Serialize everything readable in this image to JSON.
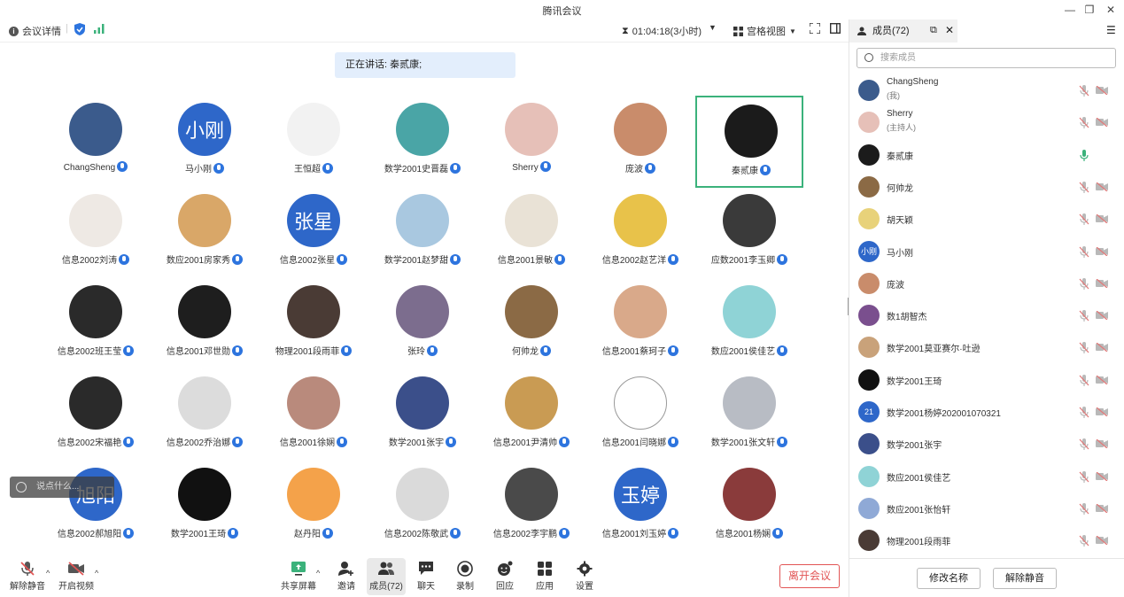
{
  "window": {
    "title": "腾讯会议"
  },
  "toolbar": {
    "meeting_info": "会议详情",
    "timer": "01:04:18(3小时)",
    "view_mode": "宫格视图"
  },
  "speaking_banner": "正在讲话: 秦贰康;",
  "grid": [
    {
      "name": "ChangSheng",
      "avatar_text": "",
      "color": "#3b5b8c"
    },
    {
      "name": "马小刚",
      "avatar_text": "小刚",
      "color": "#2e67c9"
    },
    {
      "name": "王恒超",
      "avatar_text": "",
      "color": "#f2f2f2"
    },
    {
      "name": "数学2001史晋磊",
      "avatar_text": "",
      "color": "#4aa5a6"
    },
    {
      "name": "Sherry",
      "avatar_text": "",
      "color": "#e6c0b8"
    },
    {
      "name": "庞波",
      "avatar_text": "",
      "color": "#c98c6b"
    },
    {
      "name": "秦贰康",
      "avatar_text": "",
      "color": "#1b1b1b",
      "active": true
    },
    {
      "name": "信息2002刘涛",
      "avatar_text": "",
      "color": "#eee9e4"
    },
    {
      "name": "数应2001房家秀",
      "avatar_text": "",
      "color": "#d9a768"
    },
    {
      "name": "信息2002张星",
      "avatar_text": "张星",
      "color": "#2e67c9"
    },
    {
      "name": "数学2001赵梦甜",
      "avatar_text": "",
      "color": "#a9c8e0"
    },
    {
      "name": "信息2001景敏",
      "avatar_text": "",
      "color": "#e9e2d6"
    },
    {
      "name": "信息2002赵艺洋",
      "avatar_text": "",
      "color": "#e8c24a"
    },
    {
      "name": "应数2001李玉卿",
      "avatar_text": "",
      "color": "#3a3a3a"
    },
    {
      "name": "信息2002班王莹",
      "avatar_text": "",
      "color": "#2a2a2a"
    },
    {
      "name": "信息2001邓世勋",
      "avatar_text": "",
      "color": "#1e1e1e"
    },
    {
      "name": "物理2001段雨菲",
      "avatar_text": "",
      "color": "#4a3b35"
    },
    {
      "name": "张玲",
      "avatar_text": "",
      "color": "#7c6d8e"
    },
    {
      "name": "何帅龙",
      "avatar_text": "",
      "color": "#8b6a45"
    },
    {
      "name": "信息2001蔡珂子",
      "avatar_text": "",
      "color": "#d9a98a"
    },
    {
      "name": "数应2001侯佳艺",
      "avatar_text": "",
      "color": "#8fd3d6"
    },
    {
      "name": "信息2002宋福艳",
      "avatar_text": "",
      "color": "#2a2a2a"
    },
    {
      "name": "信息2002乔治娜",
      "avatar_text": "",
      "color": "#dcdcdc"
    },
    {
      "name": "信息2001徐娴",
      "avatar_text": "",
      "color": "#b98a7c"
    },
    {
      "name": "数学2001张宇",
      "avatar_text": "",
      "color": "#3b4f8a"
    },
    {
      "name": "信息2001尹清帅",
      "avatar_text": "",
      "color": "#c99b53"
    },
    {
      "name": "信息2001闫晓娜",
      "avatar_text": "",
      "color": "#ffffff"
    },
    {
      "name": "数学2001张文轩",
      "avatar_text": "",
      "color": "#b8bcc4"
    },
    {
      "name": "信息2002郝旭阳",
      "avatar_text": "旭阳",
      "color": "#2e67c9"
    },
    {
      "name": "数学2001王琦",
      "avatar_text": "",
      "color": "#111111"
    },
    {
      "name": "赵丹阳",
      "avatar_text": "",
      "color": "#f4a24a"
    },
    {
      "name": "信息2002陈敬武",
      "avatar_text": "",
      "color": "#dadada"
    },
    {
      "name": "信息2002李宇鹏",
      "avatar_text": "",
      "color": "#4a4a4a"
    },
    {
      "name": "信息2001刘玉婷",
      "avatar_text": "玉婷",
      "color": "#2e67c9"
    },
    {
      "name": "信息2001杨娴",
      "avatar_text": "",
      "color": "#8a3b3b"
    }
  ],
  "chat_input": {
    "placeholder": "说点什么..."
  },
  "bottom": {
    "unmute": "解除静音",
    "start_video": "开启视频",
    "share_screen": "共享屏幕",
    "invite": "邀请",
    "members": "成员(72)",
    "chat": "聊天",
    "record": "录制",
    "reaction": "回应",
    "apps": "应用",
    "settings": "设置",
    "leave": "离开会议"
  },
  "panel": {
    "tab": "成员(72)",
    "search_placeholder": "搜索成员",
    "members": [
      {
        "name": "ChangSheng",
        "role": "(我)",
        "avatar_text": "",
        "color": "#3b5b8c",
        "mic": "muted"
      },
      {
        "name": "Sherry",
        "role": "(主持人)",
        "avatar_text": "",
        "color": "#e6c0b8",
        "mic": "muted"
      },
      {
        "name": "秦贰康",
        "role": "",
        "avatar_text": "",
        "color": "#1b1b1b",
        "mic": "on"
      },
      {
        "name": "何帅龙",
        "role": "",
        "avatar_text": "",
        "color": "#8b6a45",
        "mic": "muted"
      },
      {
        "name": "胡天颖",
        "role": "",
        "avatar_text": "",
        "color": "#e8d27a",
        "mic": "muted"
      },
      {
        "name": "马小刚",
        "role": "",
        "avatar_text": "小刚",
        "color": "#2e67c9",
        "mic": "muted"
      },
      {
        "name": "庞波",
        "role": "",
        "avatar_text": "",
        "color": "#c98c6b",
        "mic": "muted"
      },
      {
        "name": "数1胡智杰",
        "role": "",
        "avatar_text": "",
        "color": "#7a4f8e",
        "mic": "muted"
      },
      {
        "name": "数学2001莫亚赛尔·吐逊",
        "role": "",
        "avatar_text": "",
        "color": "#c9a27a",
        "mic": "muted"
      },
      {
        "name": "数学2001王琦",
        "role": "",
        "avatar_text": "",
        "color": "#111111",
        "mic": "muted"
      },
      {
        "name": "数学2001杨婷202001070321",
        "role": "",
        "avatar_text": "21",
        "color": "#2e67c9",
        "mic": "muted"
      },
      {
        "name": "数学2001张宇",
        "role": "",
        "avatar_text": "",
        "color": "#3b4f8a",
        "mic": "muted"
      },
      {
        "name": "数应2001侯佳艺",
        "role": "",
        "avatar_text": "",
        "color": "#8fd3d6",
        "mic": "muted"
      },
      {
        "name": "数应2001张怡轩",
        "role": "",
        "avatar_text": "",
        "color": "#8fa9d6",
        "mic": "muted"
      },
      {
        "name": "物理2001段雨菲",
        "role": "",
        "avatar_text": "",
        "color": "#4a3b35",
        "mic": "muted"
      }
    ],
    "rename_button": "修改名称",
    "unmute_all_button": "解除静音"
  },
  "colors": {
    "accent": "#2d74de",
    "active_border": "#3bb27b",
    "leave": "#e25555",
    "muted": "#e07a7a"
  }
}
